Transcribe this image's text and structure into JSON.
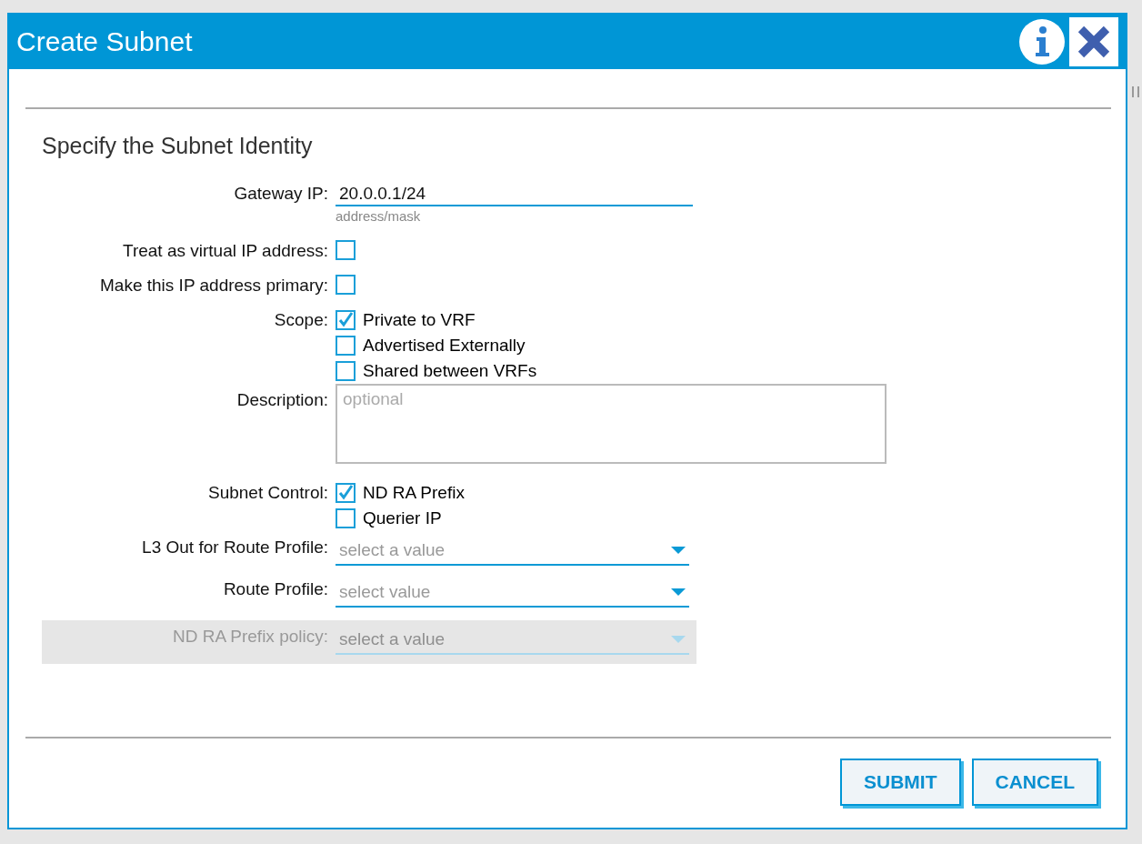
{
  "dialog": {
    "title": "Create Subnet"
  },
  "section_title": "Specify the Subnet Identity",
  "fields": [
    {
      "kind": "text",
      "label": "Gateway IP:",
      "value": "20.0.0.1/24",
      "hint": "address/mask"
    },
    {
      "kind": "checkbox",
      "label": "Treat as virtual IP address:",
      "checked": false
    },
    {
      "kind": "checkbox",
      "label": "Make this IP address primary:",
      "checked": false
    },
    {
      "kind": "checkgroup",
      "label": "Scope:",
      "options": [
        {
          "label": "Private to VRF",
          "checked": true
        },
        {
          "label": "Advertised Externally",
          "checked": false
        },
        {
          "label": "Shared between VRFs",
          "checked": false
        }
      ]
    },
    {
      "kind": "textarea",
      "label": "Description:",
      "placeholder": "optional"
    },
    {
      "kind": "checkgroup",
      "label": "Subnet Control:",
      "options": [
        {
          "label": "ND RA Prefix",
          "checked": true
        },
        {
          "label": "Querier IP",
          "checked": false
        }
      ]
    },
    {
      "kind": "select",
      "label": "L3 Out for Route Profile:",
      "placeholder": "select a value",
      "disabled": false
    },
    {
      "kind": "select",
      "label": "Route Profile:",
      "placeholder": "select value",
      "disabled": false
    },
    {
      "kind": "select",
      "label": "ND RA Prefix policy:",
      "placeholder": "select a value",
      "disabled": true
    }
  ],
  "buttons": [
    "SUBMIT",
    "CANCEL"
  ]
}
